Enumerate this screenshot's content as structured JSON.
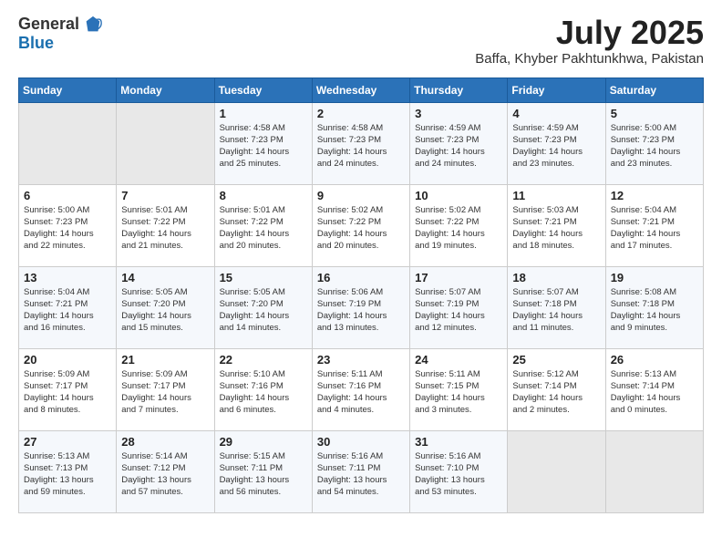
{
  "header": {
    "logo": {
      "general": "General",
      "blue": "Blue"
    },
    "title": "July 2025",
    "location": "Baffa, Khyber Pakhtunkhwa, Pakistan"
  },
  "calendar": {
    "days_of_week": [
      "Sunday",
      "Monday",
      "Tuesday",
      "Wednesday",
      "Thursday",
      "Friday",
      "Saturday"
    ],
    "weeks": [
      [
        {
          "day": "",
          "info": ""
        },
        {
          "day": "",
          "info": ""
        },
        {
          "day": "1",
          "info": "Sunrise: 4:58 AM\nSunset: 7:23 PM\nDaylight: 14 hours\nand 25 minutes."
        },
        {
          "day": "2",
          "info": "Sunrise: 4:58 AM\nSunset: 7:23 PM\nDaylight: 14 hours\nand 24 minutes."
        },
        {
          "day": "3",
          "info": "Sunrise: 4:59 AM\nSunset: 7:23 PM\nDaylight: 14 hours\nand 24 minutes."
        },
        {
          "day": "4",
          "info": "Sunrise: 4:59 AM\nSunset: 7:23 PM\nDaylight: 14 hours\nand 23 minutes."
        },
        {
          "day": "5",
          "info": "Sunrise: 5:00 AM\nSunset: 7:23 PM\nDaylight: 14 hours\nand 23 minutes."
        }
      ],
      [
        {
          "day": "6",
          "info": "Sunrise: 5:00 AM\nSunset: 7:23 PM\nDaylight: 14 hours\nand 22 minutes."
        },
        {
          "day": "7",
          "info": "Sunrise: 5:01 AM\nSunset: 7:22 PM\nDaylight: 14 hours\nand 21 minutes."
        },
        {
          "day": "8",
          "info": "Sunrise: 5:01 AM\nSunset: 7:22 PM\nDaylight: 14 hours\nand 20 minutes."
        },
        {
          "day": "9",
          "info": "Sunrise: 5:02 AM\nSunset: 7:22 PM\nDaylight: 14 hours\nand 20 minutes."
        },
        {
          "day": "10",
          "info": "Sunrise: 5:02 AM\nSunset: 7:22 PM\nDaylight: 14 hours\nand 19 minutes."
        },
        {
          "day": "11",
          "info": "Sunrise: 5:03 AM\nSunset: 7:21 PM\nDaylight: 14 hours\nand 18 minutes."
        },
        {
          "day": "12",
          "info": "Sunrise: 5:04 AM\nSunset: 7:21 PM\nDaylight: 14 hours\nand 17 minutes."
        }
      ],
      [
        {
          "day": "13",
          "info": "Sunrise: 5:04 AM\nSunset: 7:21 PM\nDaylight: 14 hours\nand 16 minutes."
        },
        {
          "day": "14",
          "info": "Sunrise: 5:05 AM\nSunset: 7:20 PM\nDaylight: 14 hours\nand 15 minutes."
        },
        {
          "day": "15",
          "info": "Sunrise: 5:05 AM\nSunset: 7:20 PM\nDaylight: 14 hours\nand 14 minutes."
        },
        {
          "day": "16",
          "info": "Sunrise: 5:06 AM\nSunset: 7:19 PM\nDaylight: 14 hours\nand 13 minutes."
        },
        {
          "day": "17",
          "info": "Sunrise: 5:07 AM\nSunset: 7:19 PM\nDaylight: 14 hours\nand 12 minutes."
        },
        {
          "day": "18",
          "info": "Sunrise: 5:07 AM\nSunset: 7:18 PM\nDaylight: 14 hours\nand 11 minutes."
        },
        {
          "day": "19",
          "info": "Sunrise: 5:08 AM\nSunset: 7:18 PM\nDaylight: 14 hours\nand 9 minutes."
        }
      ],
      [
        {
          "day": "20",
          "info": "Sunrise: 5:09 AM\nSunset: 7:17 PM\nDaylight: 14 hours\nand 8 minutes."
        },
        {
          "day": "21",
          "info": "Sunrise: 5:09 AM\nSunset: 7:17 PM\nDaylight: 14 hours\nand 7 minutes."
        },
        {
          "day": "22",
          "info": "Sunrise: 5:10 AM\nSunset: 7:16 PM\nDaylight: 14 hours\nand 6 minutes."
        },
        {
          "day": "23",
          "info": "Sunrise: 5:11 AM\nSunset: 7:16 PM\nDaylight: 14 hours\nand 4 minutes."
        },
        {
          "day": "24",
          "info": "Sunrise: 5:11 AM\nSunset: 7:15 PM\nDaylight: 14 hours\nand 3 minutes."
        },
        {
          "day": "25",
          "info": "Sunrise: 5:12 AM\nSunset: 7:14 PM\nDaylight: 14 hours\nand 2 minutes."
        },
        {
          "day": "26",
          "info": "Sunrise: 5:13 AM\nSunset: 7:14 PM\nDaylight: 14 hours\nand 0 minutes."
        }
      ],
      [
        {
          "day": "27",
          "info": "Sunrise: 5:13 AM\nSunset: 7:13 PM\nDaylight: 13 hours\nand 59 minutes."
        },
        {
          "day": "28",
          "info": "Sunrise: 5:14 AM\nSunset: 7:12 PM\nDaylight: 13 hours\nand 57 minutes."
        },
        {
          "day": "29",
          "info": "Sunrise: 5:15 AM\nSunset: 7:11 PM\nDaylight: 13 hours\nand 56 minutes."
        },
        {
          "day": "30",
          "info": "Sunrise: 5:16 AM\nSunset: 7:11 PM\nDaylight: 13 hours\nand 54 minutes."
        },
        {
          "day": "31",
          "info": "Sunrise: 5:16 AM\nSunset: 7:10 PM\nDaylight: 13 hours\nand 53 minutes."
        },
        {
          "day": "",
          "info": ""
        },
        {
          "day": "",
          "info": ""
        }
      ]
    ]
  }
}
